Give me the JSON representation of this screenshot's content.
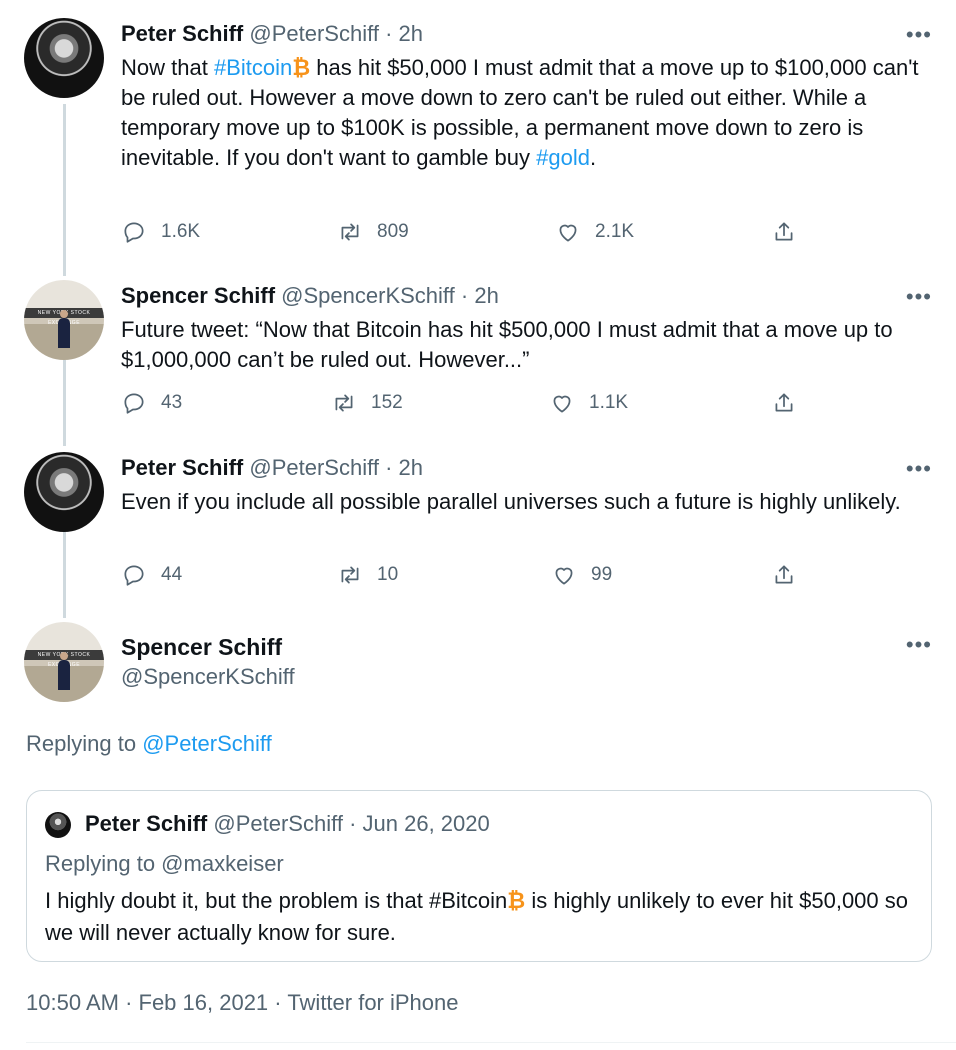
{
  "thread": [
    {
      "name": "Peter Schiff",
      "handle": "@PeterSchiff",
      "dot": "·",
      "time": "2h",
      "body_parts": {
        "p1": "Now that ",
        "hashtag1": "#Bitcoin",
        "p2": " has hit $50,000 I must admit that a move up to $100,000 can't be ruled out. However a move down to zero can't be ruled out either. While a temporary move up to $100K is possible, a permanent move down to zero is inevitable. If you don't want to gamble buy ",
        "hashtag2": "#gold",
        "p3": "."
      },
      "replies": "1.6K",
      "retweets": "809",
      "likes": "2.1K"
    },
    {
      "name": "Spencer Schiff",
      "handle": "@SpencerKSchiff",
      "dot": "·",
      "time": "2h",
      "body": "Future tweet: “Now that Bitcoin has hit $500,000 I must admit that a move up to $1,000,000 can’t be ruled out. However...”",
      "replies": "43",
      "retweets": "152",
      "likes": "1.1K"
    },
    {
      "name": "Peter Schiff",
      "handle": "@PeterSchiff",
      "dot": "·",
      "time": "2h",
      "body": "Even if you include all possible parallel universes such a future is highly unlikely.",
      "replies": "44",
      "retweets": "10",
      "likes": "99"
    }
  ],
  "main_tweet": {
    "name": "Spencer Schiff",
    "handle": "@SpencerKSchiff",
    "replying_label": "Replying to ",
    "replying_handle": "@PeterSchiff",
    "quote": {
      "name": "Peter Schiff",
      "handle": "@PeterSchiff",
      "dot": "·",
      "date": "Jun 26, 2020",
      "replying": "Replying to @maxkeiser",
      "p1": "I highly doubt it, but the problem is that #Bitcoin",
      "p2": " is highly unlikely to ever hit $50,000 so we will never actually know for sure."
    },
    "timestamp": "10:50 AM · Feb 16, 2021 · Twitter for iPhone"
  },
  "more_label": "•••",
  "bitcoin_glyph": "₿",
  "avatar_banner_text": "NEW YORK STOCK EXCHANGE",
  "icons": {
    "reply": "reply-icon",
    "retweet": "retweet-icon",
    "like": "heart-icon",
    "share": "share-icon"
  },
  "colors": {
    "link": "#1d9bf0",
    "muted": "#536471",
    "bitcoin": "#f7931a"
  }
}
